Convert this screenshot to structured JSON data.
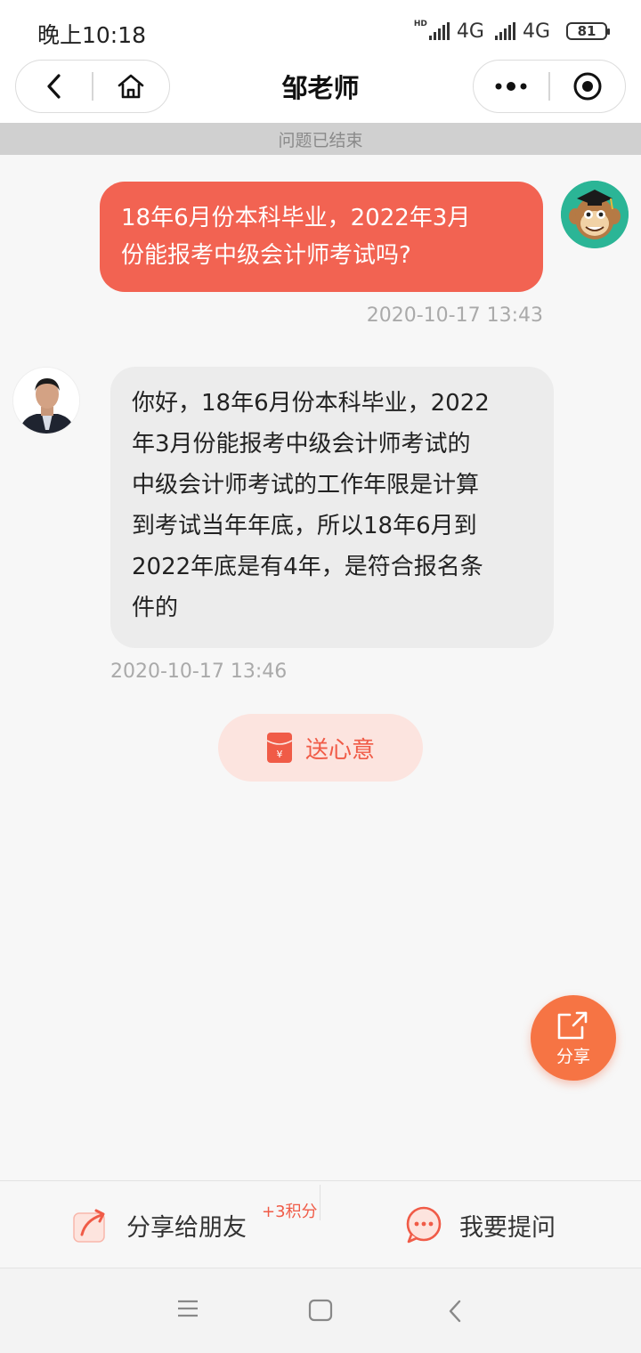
{
  "status_bar": {
    "time": "晚上10:18",
    "network_1": "4G",
    "network_2": "4G",
    "hd_label": "HD",
    "battery": "81"
  },
  "nav": {
    "title": "邹老师",
    "icons": [
      "back-icon",
      "home-icon",
      "more-icon",
      "close-target-icon"
    ]
  },
  "banner": {
    "text": "问题已结束"
  },
  "chat": {
    "messages": [
      {
        "sender": "user",
        "line1": "18年6月份本科毕业，2022年3月",
        "line2": "份能报考中级会计师考试吗?",
        "time": "2020-10-17 13:43"
      },
      {
        "sender": "teacher",
        "lines": [
          "你好，18年6月份本科毕业，2022",
          "年3月份能报考中级会计师考试的",
          "中级会计师考试的工作年限是计算",
          "到考试当年年底，所以18年6月到",
          "2022年底是有4年，是符合报名条",
          "件的"
        ],
        "time": "2020-10-17 13:46"
      }
    ],
    "gift_button": "送心意",
    "gift_icon_char": "¥"
  },
  "fab": {
    "label": "分享"
  },
  "bottom_bar": {
    "share_label": "分享给朋友",
    "points": "+3积分",
    "ask_label": "我要提问"
  },
  "colors": {
    "accent": "#f26352",
    "fab": "#f67444",
    "gift_bg": "#fce4df",
    "avatar_bg": "#2bb596"
  }
}
